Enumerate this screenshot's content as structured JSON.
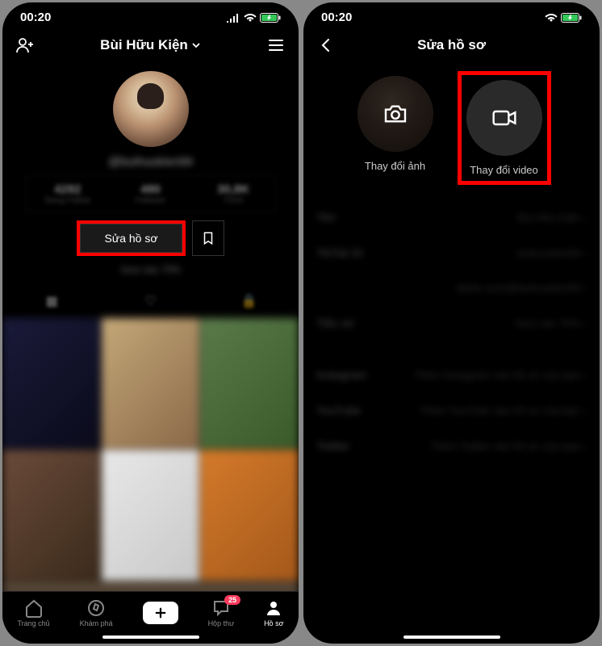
{
  "status": {
    "time": "00:20"
  },
  "screen1": {
    "profile_name": "Bùi Hữu Kiện",
    "username": "@buihuukien99",
    "stats": [
      {
        "num": "4282",
        "label": "Đang Follow"
      },
      {
        "num": "480",
        "label": "Follower"
      },
      {
        "num": "30,8K",
        "label": "Thích"
      }
    ],
    "edit_button": "Sửa hồ sơ",
    "bio": "Xem vào 70%",
    "nav": {
      "home": "Trang chủ",
      "discover": "Khám phá",
      "inbox": "Hộp thư",
      "inbox_badge": "25",
      "profile": "Hồ sơ"
    }
  },
  "screen2": {
    "title": "Sửa hồ sơ",
    "change_photo": "Thay đổi ảnh",
    "change_video": "Thay đổi video",
    "rows": [
      {
        "label": "Tên",
        "value": "Bùi Hữu Kiện"
      },
      {
        "label": "TikTok ID",
        "value": "buihuukien99"
      },
      {
        "label": "",
        "value": "tiktok.com/@buihuukien99"
      },
      {
        "label": "Tiểu sử",
        "value": "Xem vào 70%"
      },
      {
        "label": "Instagram",
        "value": "Thêm Instagram vào hồ sơ của bạn"
      },
      {
        "label": "YouTube",
        "value": "Thêm YouTube vào hồ sơ của bạn"
      },
      {
        "label": "Twitter",
        "value": "Thêm Twitter vào hồ sơ của bạn"
      }
    ]
  }
}
